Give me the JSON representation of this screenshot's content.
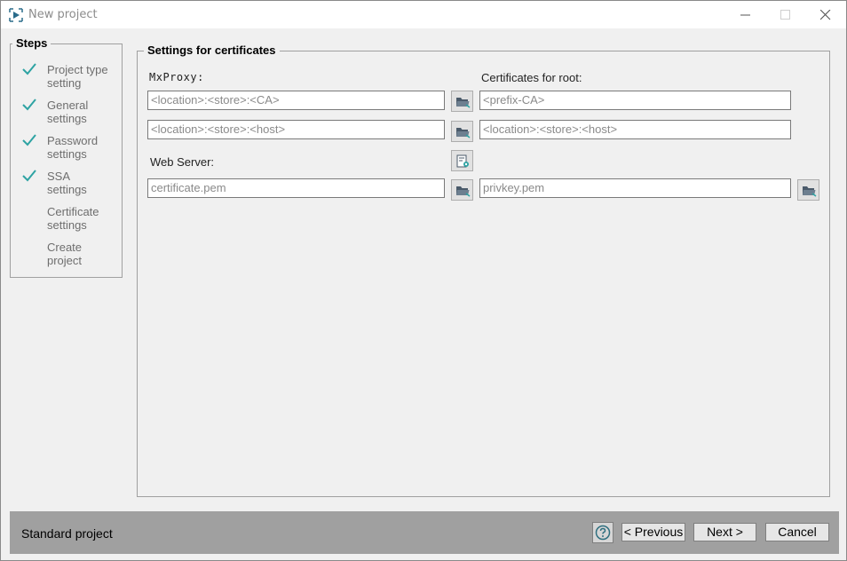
{
  "window": {
    "title": "New project"
  },
  "steps": {
    "title": "Steps",
    "items": [
      {
        "line1": "Project type",
        "line2": "setting",
        "done": true
      },
      {
        "line1": "General",
        "line2": "settings",
        "done": true
      },
      {
        "line1": "Password",
        "line2": "settings",
        "done": true
      },
      {
        "line1": "SSA",
        "line2": "settings",
        "done": true
      },
      {
        "line1": "Certificate",
        "line2": "settings",
        "done": false
      },
      {
        "line1": "Create",
        "line2": "project",
        "done": false
      }
    ]
  },
  "settings": {
    "title": "Settings for certificates",
    "mxproxy_label": "MxProxy:",
    "root_label": "Certificates for root:",
    "webserver_label": "Web Server:",
    "mxproxy_ca": "<location>:<store>:<CA>",
    "mxproxy_host": "<location>:<store>:<host>",
    "root_ca": "<prefix-CA>",
    "root_host": "<location>:<store>:<host>",
    "web_cert": "certificate.pem",
    "web_key": "privkey.pem"
  },
  "footer": {
    "project_type": "Standard project",
    "previous_label": "< Previous",
    "next_label": "Next >",
    "cancel_label": "Cancel"
  },
  "colors": {
    "check": "#2ea3a3",
    "footer_bg": "#a0a0a0",
    "folder_icon": "#4a5a6a"
  }
}
